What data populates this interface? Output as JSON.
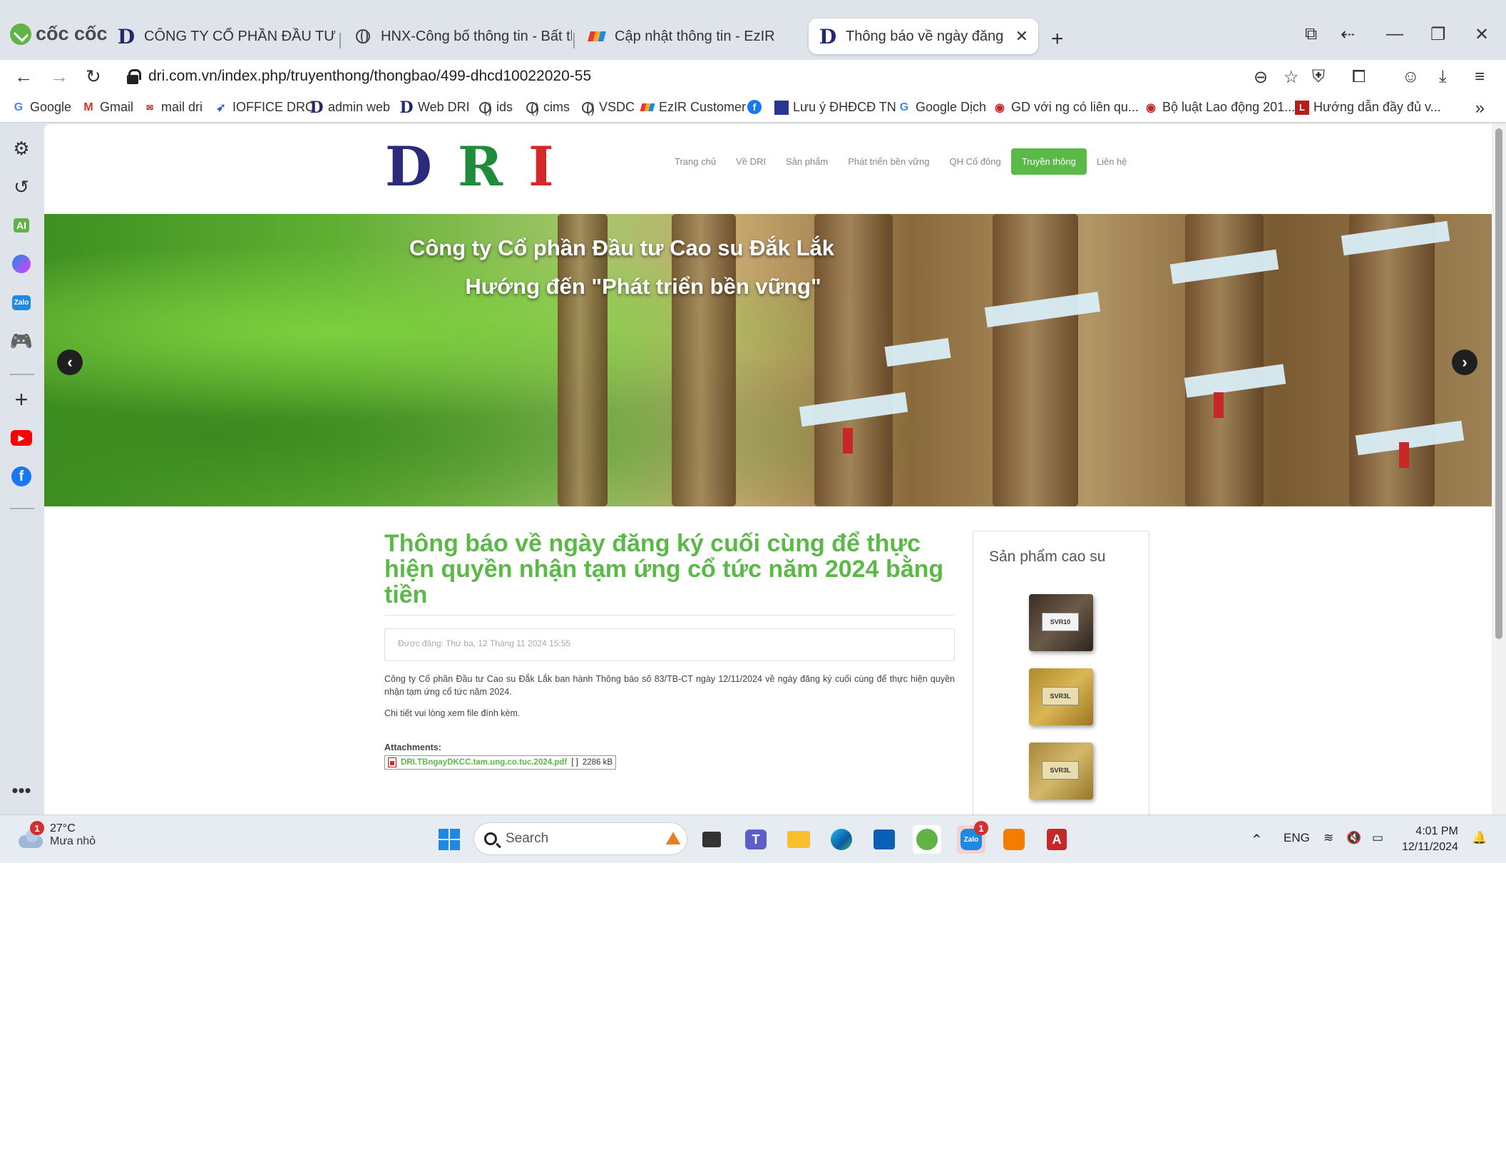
{
  "browser": {
    "brand": "cốc cốc",
    "tabs": [
      {
        "label": "CÔNG TY CỔ PHẦN ĐẦU TƯ CAO",
        "icon": "dri-d-icon"
      },
      {
        "label": "HNX-Công bố thông tin - Bất thườ",
        "icon": "globe-icon"
      },
      {
        "label": "Cập nhật thông tin - EzIR",
        "icon": "ezir-icon"
      },
      {
        "label": "Thông báo về ngày đăng ký c",
        "icon": "dri-d-icon",
        "active": true
      }
    ],
    "url": "dri.com.vn/index.php/truyenthong/thongbao/499-dhcd10022020-55",
    "bookmarks": [
      "Google",
      "Gmail",
      "mail dri",
      "IOFFICE DRC",
      "admin web",
      "Web DRI",
      "ids",
      "cims",
      "VSDC",
      "EzIR Customer",
      "",
      "Lưu ý ĐHĐCĐ TN",
      "Google Dịch",
      "GD với ng có liên qu...",
      "Bộ luật Lao động 201...",
      "Hướng dẫn đầy đủ v..."
    ]
  },
  "site": {
    "logo": [
      "D",
      "R",
      "I"
    ],
    "logo_colors": [
      "#2c2a7a",
      "#1e8c3a",
      "#d62828"
    ],
    "nav": [
      "Trang chủ",
      "Về DRI",
      "Sản phẩm",
      "Phát triển bền vững",
      "QH Cổ đông",
      "Truyền thông",
      "Liên hệ"
    ],
    "nav_active": "Truyền thông",
    "accent": "#5ab947",
    "banner": {
      "line1": "Công ty Cổ phần Đầu tư Cao su Đắk Lắk",
      "line2": "Hướng đến \"Phát triển bền vững\""
    },
    "article": {
      "title": "Thông báo về ngày đăng ký cuối cùng để thực hiện quyền nhận tạm ứng cổ tức năm 2024 bằng tiền",
      "meta": "Được đăng: Thứ ba, 12 Tháng 11 2024 15:55",
      "body1": "Công ty Cổ phần Đầu tư Cao su Đắk Lắk ban hành Thông báo số 83/TB-CT ngày 12/11/2024 về ngày đăng ký cuối cùng để thực hiện quyền nhận tạm ứng cổ tức năm 2024.",
      "body2": "Chi tiết vui lòng xem file đính kèm.",
      "attachments_label": "Attachments:",
      "attachment_file": "DRI.TBngayDKCC.tam.ung.co.tuc.2024.pdf",
      "attachment_bracket": "[ ]",
      "attachment_size": "2286 kB"
    },
    "products": {
      "title": "Sản phẩm cao su",
      "items": [
        "SVR10",
        "SVR3L",
        "SVR3L"
      ]
    }
  },
  "taskbar": {
    "weather_temp": "27°C",
    "weather_desc": "Mưa nhỏ",
    "weather_badge": "1",
    "search_placeholder": "Search",
    "zalo_badge": "1",
    "lang": "ENG",
    "time": "4:01 PM",
    "date": "12/11/2024"
  }
}
